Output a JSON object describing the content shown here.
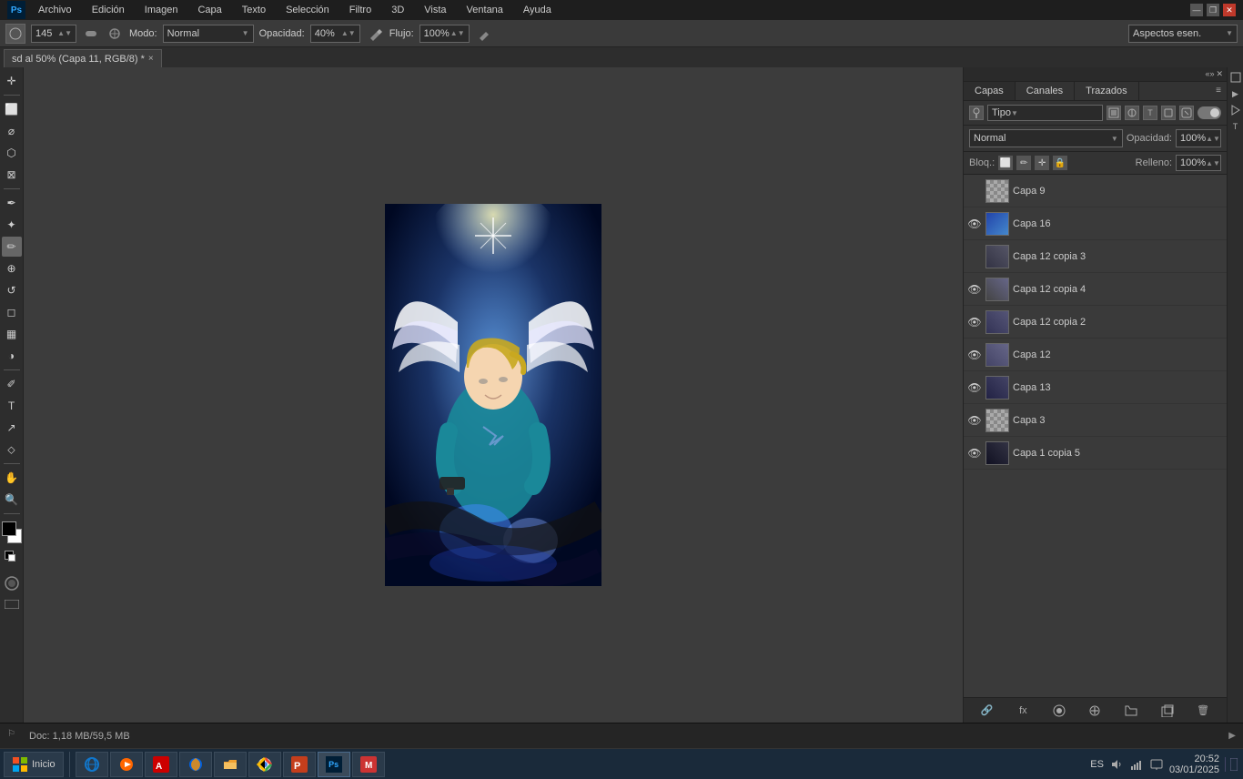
{
  "app": {
    "logo": "Ps",
    "title": "Adobe Photoshop"
  },
  "title_bar": {
    "controls": [
      "—",
      "❐",
      "✕"
    ]
  },
  "menu_bar": {
    "items": [
      "Archivo",
      "Edición",
      "Imagen",
      "Capa",
      "Texto",
      "Selección",
      "Filtro",
      "3D",
      "Vista",
      "Ventana",
      "Ayuda"
    ]
  },
  "options_bar": {
    "brush_size": "145",
    "mode_label": "Modo:",
    "mode_value": "Normal",
    "opacity_label": "Opacidad:",
    "opacity_value": "40%",
    "flow_label": "Flujo:",
    "flow_value": "100%"
  },
  "tab": {
    "name": "sd al 50% (Capa 11, RGB/8) *",
    "close": "×"
  },
  "workspace_dropdown": {
    "label": "Aspectos esen."
  },
  "canvas": {
    "info": "Lienzo principal"
  },
  "layers_panel": {
    "tabs": [
      "Capas",
      "Canales",
      "Trazados"
    ],
    "filter_label": "Tipo",
    "mode_label": "Normal",
    "opacity_label": "Opacidad:",
    "opacity_value": "100%",
    "lock_label": "Bloq.:",
    "fill_label": "Relleno:",
    "fill_value": "100%",
    "layers": [
      {
        "name": "Capa 9",
        "visible": true,
        "has_thumb": false
      },
      {
        "name": "Capa 16",
        "visible": true,
        "has_thumb": true
      },
      {
        "name": "Capa 12 copia 3",
        "visible": false,
        "has_thumb": true
      },
      {
        "name": "Capa 12 copia 4",
        "visible": true,
        "has_thumb": true
      },
      {
        "name": "Capa 12 copia 2",
        "visible": true,
        "has_thumb": true
      },
      {
        "name": "Capa 12",
        "visible": true,
        "has_thumb": true
      },
      {
        "name": "Capa 13",
        "visible": true,
        "has_thumb": true
      },
      {
        "name": "Capa 3",
        "visible": true,
        "has_thumb": false
      },
      {
        "name": "Capa 1 copia 5",
        "visible": true,
        "has_thumb": true
      }
    ]
  },
  "status_bar": {
    "doc_info": "Doc: 1,18 MB/59,5 MB"
  },
  "taskbar": {
    "start_label": "Inicio",
    "apps": [
      "IE",
      "WMP",
      "Adobe Reader",
      "Firefox",
      "Explorer",
      "Chrome",
      "PowerPoint",
      "Photoshop",
      "Unknown"
    ],
    "clock": "20:52",
    "date": "03/01/2025",
    "lang": "ES"
  },
  "tools": [
    {
      "name": "move",
      "icon": "✛"
    },
    {
      "name": "rectangular-marquee",
      "icon": "⬜"
    },
    {
      "name": "lasso",
      "icon": "⌀"
    },
    {
      "name": "quick-select",
      "icon": "⬡"
    },
    {
      "name": "crop",
      "icon": "⊠"
    },
    {
      "name": "eyedropper",
      "icon": "✒"
    },
    {
      "name": "spot-healing",
      "icon": "✦"
    },
    {
      "name": "brush",
      "icon": "✏"
    },
    {
      "name": "clone-stamp",
      "icon": "⊕"
    },
    {
      "name": "history-brush",
      "icon": "↺"
    },
    {
      "name": "eraser",
      "icon": "◻"
    },
    {
      "name": "gradient",
      "icon": "▦"
    },
    {
      "name": "dodge",
      "icon": "◑"
    },
    {
      "name": "pen",
      "icon": "✐"
    },
    {
      "name": "type",
      "icon": "T"
    },
    {
      "name": "path-select",
      "icon": "↗"
    },
    {
      "name": "shape",
      "icon": "⬦"
    },
    {
      "name": "hand",
      "icon": "✋"
    },
    {
      "name": "zoom",
      "icon": "🔍"
    }
  ]
}
